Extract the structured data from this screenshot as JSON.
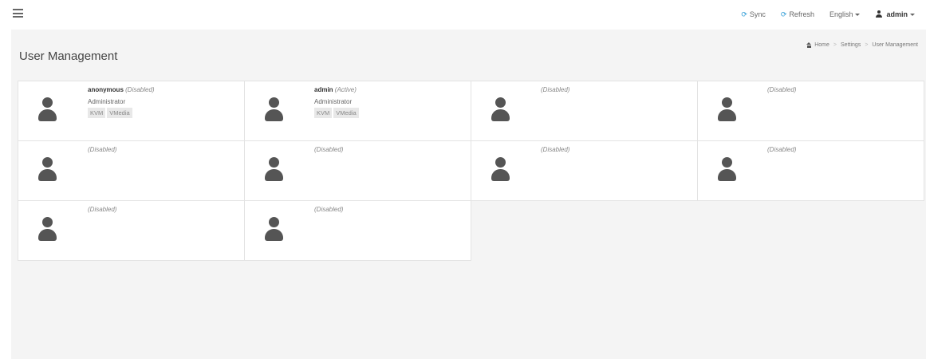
{
  "topnav": {
    "sync_label": "Sync",
    "refresh_label": "Refresh",
    "language_label": "English",
    "user_label": "admin"
  },
  "page": {
    "title": "User Management"
  },
  "breadcrumb": {
    "home": "Home",
    "settings": "Settings",
    "current": "User Management"
  },
  "users": [
    {
      "name": "anonymous",
      "status": "(Disabled)",
      "role": "Administrator",
      "tags": [
        "KVM",
        "VMedia"
      ]
    },
    {
      "name": "admin",
      "status": "(Active)",
      "role": "Administrator",
      "tags": [
        "KVM",
        "VMedia"
      ]
    },
    {
      "name": "",
      "status": "(Disabled)",
      "role": "",
      "tags": []
    },
    {
      "name": "",
      "status": "(Disabled)",
      "role": "",
      "tags": []
    },
    {
      "name": "",
      "status": "(Disabled)",
      "role": "",
      "tags": []
    },
    {
      "name": "",
      "status": "(Disabled)",
      "role": "",
      "tags": []
    },
    {
      "name": "",
      "status": "(Disabled)",
      "role": "",
      "tags": []
    },
    {
      "name": "",
      "status": "(Disabled)",
      "role": "",
      "tags": []
    },
    {
      "name": "",
      "status": "(Disabled)",
      "role": "",
      "tags": []
    },
    {
      "name": "",
      "status": "(Disabled)",
      "role": "",
      "tags": []
    }
  ],
  "icons": {
    "menu": "hamburger-menu-icon",
    "sync": "sync-icon",
    "refresh": "refresh-icon",
    "user": "user-icon",
    "home": "home-icon",
    "avatar": "user-avatar-icon"
  },
  "colors": {
    "accent": "#2e9bd6",
    "background": "#f4f4f4",
    "card": "#ffffff",
    "avatar": "#555555"
  }
}
